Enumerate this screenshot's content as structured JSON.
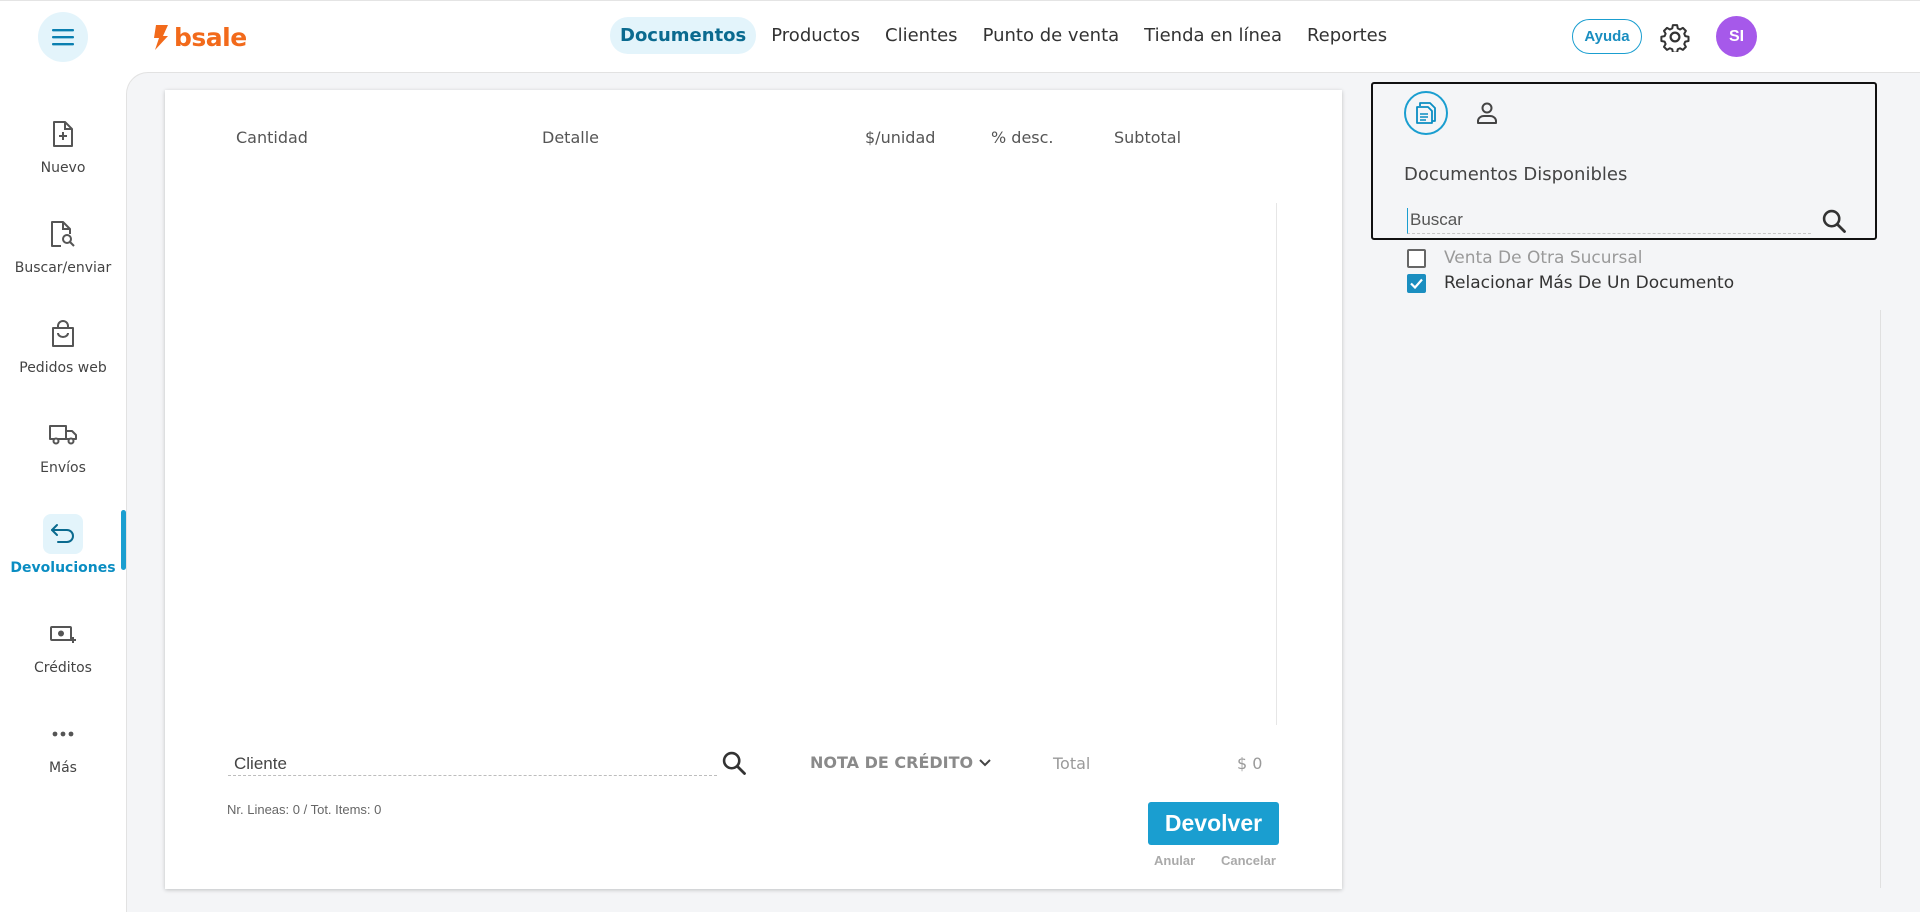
{
  "header": {
    "logo_text": "bsale",
    "nav": [
      {
        "label": "Documentos",
        "active": true
      },
      {
        "label": "Productos",
        "active": false
      },
      {
        "label": "Clientes",
        "active": false
      },
      {
        "label": "Punto de venta",
        "active": false
      },
      {
        "label": "Tienda en línea",
        "active": false
      },
      {
        "label": "Reportes",
        "active": false
      }
    ],
    "help_label": "Ayuda",
    "avatar_initials": "SI",
    "colors": {
      "accent": "#1a9ed0",
      "brand": "#f26a1b",
      "avatar": "#a659ea"
    }
  },
  "sidebar": {
    "items": [
      {
        "label": "Nuevo",
        "icon": "file-plus-icon"
      },
      {
        "label": "Buscar/enviar",
        "icon": "file-search-icon"
      },
      {
        "label": "Pedidos web",
        "icon": "shopping-bag-icon"
      },
      {
        "label": "Envíos",
        "icon": "truck-icon"
      },
      {
        "label": "Devoluciones",
        "icon": "return-arrow-icon",
        "active": true
      },
      {
        "label": "Créditos",
        "icon": "cash-plus-icon"
      },
      {
        "label": "Más",
        "icon": "more-dots-icon"
      }
    ]
  },
  "document": {
    "columns": [
      "Cantidad",
      "Detalle",
      "$/unidad",
      "% desc.",
      "Subtotal"
    ],
    "client_placeholder": "Cliente",
    "doc_type": "NOTA DE CRÉDITO",
    "total_label": "Total",
    "total_value": "$ 0",
    "lines_info": "Nr. Lineas: 0 / Tot. Items: 0",
    "primary_action": "Devolver",
    "secondary_actions": [
      "Anular",
      "Cancelar"
    ]
  },
  "panel": {
    "title": "Documentos Disponibles",
    "search_placeholder": "Buscar",
    "options": [
      {
        "label": "Venta De Otra Sucursal",
        "checked": false
      },
      {
        "label": "Relacionar Más De Un Documento",
        "checked": true
      }
    ]
  }
}
